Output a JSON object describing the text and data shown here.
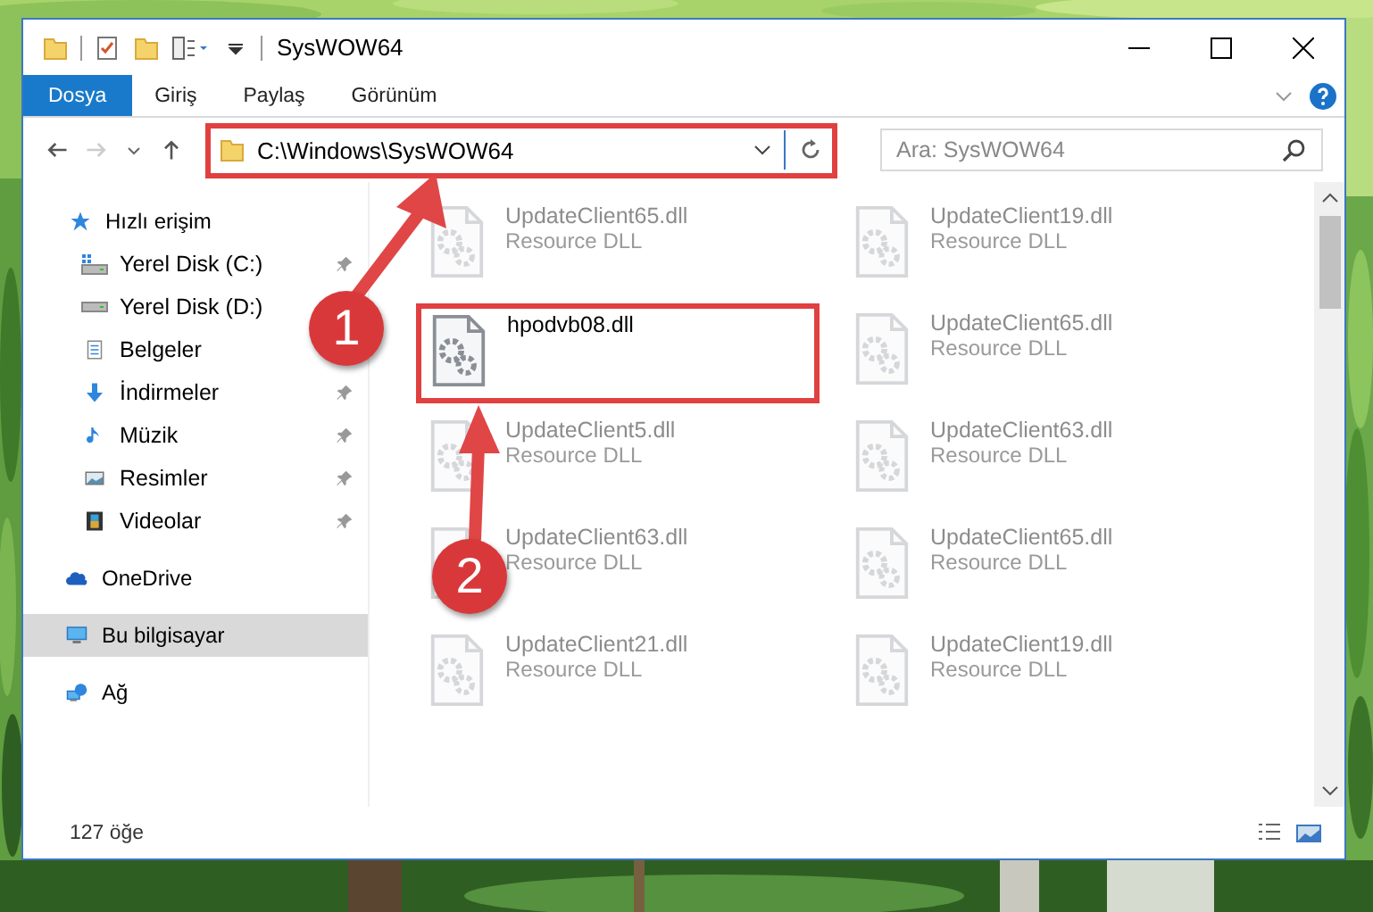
{
  "window": {
    "title": "SysWOW64"
  },
  "ribbon_tabs": [
    {
      "label": "Dosya",
      "kind": "file",
      "selected": false
    },
    {
      "label": "Giriş",
      "kind": "tab",
      "selected": false
    },
    {
      "label": "Paylaş",
      "kind": "tab",
      "selected": false
    },
    {
      "label": "Görünüm",
      "kind": "tab",
      "selected": false
    }
  ],
  "address_bar": {
    "path": "C:\\Windows\\SysWOW64",
    "highlighted": true
  },
  "search": {
    "placeholder": "Ara: SysWOW64"
  },
  "sidebar": {
    "items": [
      {
        "label": "Hızlı erişim",
        "kind": "quick",
        "pinned": false,
        "selected": false,
        "children": [
          {
            "label": "Yerel Disk (C:)",
            "kind": "drive-c",
            "pinned": true,
            "selected": false
          },
          {
            "label": "Yerel Disk (D:)",
            "kind": "drive",
            "pinned": false,
            "selected": false
          },
          {
            "label": "Belgeler",
            "kind": "documents",
            "pinned": false,
            "selected": false
          },
          {
            "label": "İndirmeler",
            "kind": "downloads",
            "pinned": true,
            "selected": false
          },
          {
            "label": "Müzik",
            "kind": "music",
            "pinned": true,
            "selected": false
          },
          {
            "label": "Resimler",
            "kind": "pictures",
            "pinned": true,
            "selected": false
          },
          {
            "label": "Videolar",
            "kind": "videos",
            "pinned": true,
            "selected": false
          }
        ]
      },
      {
        "label": "OneDrive",
        "kind": "cloud",
        "pinned": false,
        "selected": false
      },
      {
        "label": "Bu bilgisayar",
        "kind": "computer",
        "pinned": false,
        "selected": true
      },
      {
        "label": "Ağ",
        "kind": "network",
        "pinned": false,
        "selected": false
      }
    ]
  },
  "files": [
    {
      "name": "UpdateClient65.dll",
      "type": "Resource DLL",
      "faded": true,
      "highlighted": false
    },
    {
      "name": "UpdateClient19.dll",
      "type": "Resource DLL",
      "faded": true,
      "highlighted": false
    },
    {
      "name": "hpodvb08.dll",
      "faded": false,
      "highlighted": true
    },
    {
      "name": "UpdateClient65.dll",
      "type": "Resource DLL",
      "faded": true,
      "highlighted": false
    },
    {
      "name": "UpdateClient5.dll",
      "type": "Resource DLL",
      "faded": true,
      "highlighted": false
    },
    {
      "name": "UpdateClient63.dll",
      "type": "Resource DLL",
      "faded": true,
      "highlighted": false
    },
    {
      "name": "UpdateClient63.dll",
      "type": "Resource DLL",
      "faded": true,
      "highlighted": false
    },
    {
      "name": "UpdateClient65.dll",
      "type": "Resource DLL",
      "faded": true,
      "highlighted": false
    },
    {
      "name": "UpdateClient21.dll",
      "type": "Resource DLL",
      "faded": true,
      "highlighted": false
    },
    {
      "name": "UpdateClient19.dll",
      "type": "Resource DLL",
      "faded": true,
      "highlighted": false
    }
  ],
  "status_bar": {
    "item_count": "127 öğe"
  },
  "annotations": [
    {
      "number": "1"
    },
    {
      "number": "2"
    }
  ]
}
